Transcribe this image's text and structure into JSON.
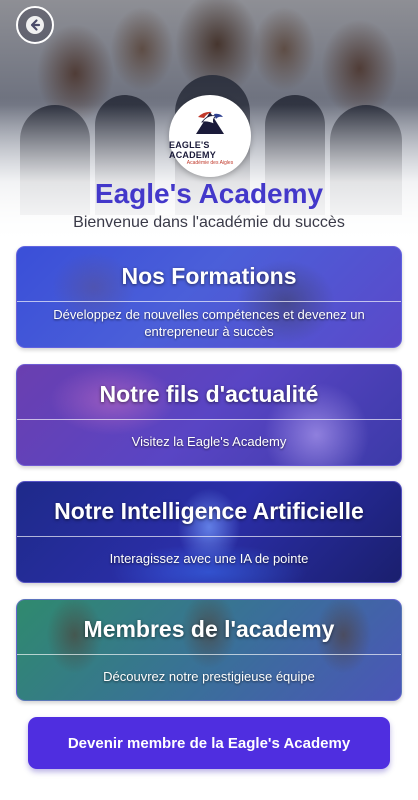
{
  "header": {
    "back_icon": "back-arrow-icon",
    "logo": {
      "name": "EAGLE'S ACADEMY",
      "subtitle": "Académie des Aigles"
    },
    "title": "Eagle's Academy",
    "subtitle": "Bienvenue dans l'académie du succès"
  },
  "cards": [
    {
      "title": "Nos Formations",
      "description": "Développez de nouvelles compétences et devenez un entrepreneur à succès"
    },
    {
      "title": "Notre fils d'actualité",
      "description": "Visitez la Eagle's Academy"
    },
    {
      "title": "Notre Intelligence Artificielle",
      "description": "Interagissez avec une IA de pointe"
    },
    {
      "title": "Membres de l'academy",
      "description": "Découvrez notre prestigieuse équipe"
    }
  ],
  "cta": {
    "label": "Devenir membre de la Eagle's Academy"
  },
  "colors": {
    "brand": "#4338ca",
    "cta": "#4f2ee0"
  }
}
